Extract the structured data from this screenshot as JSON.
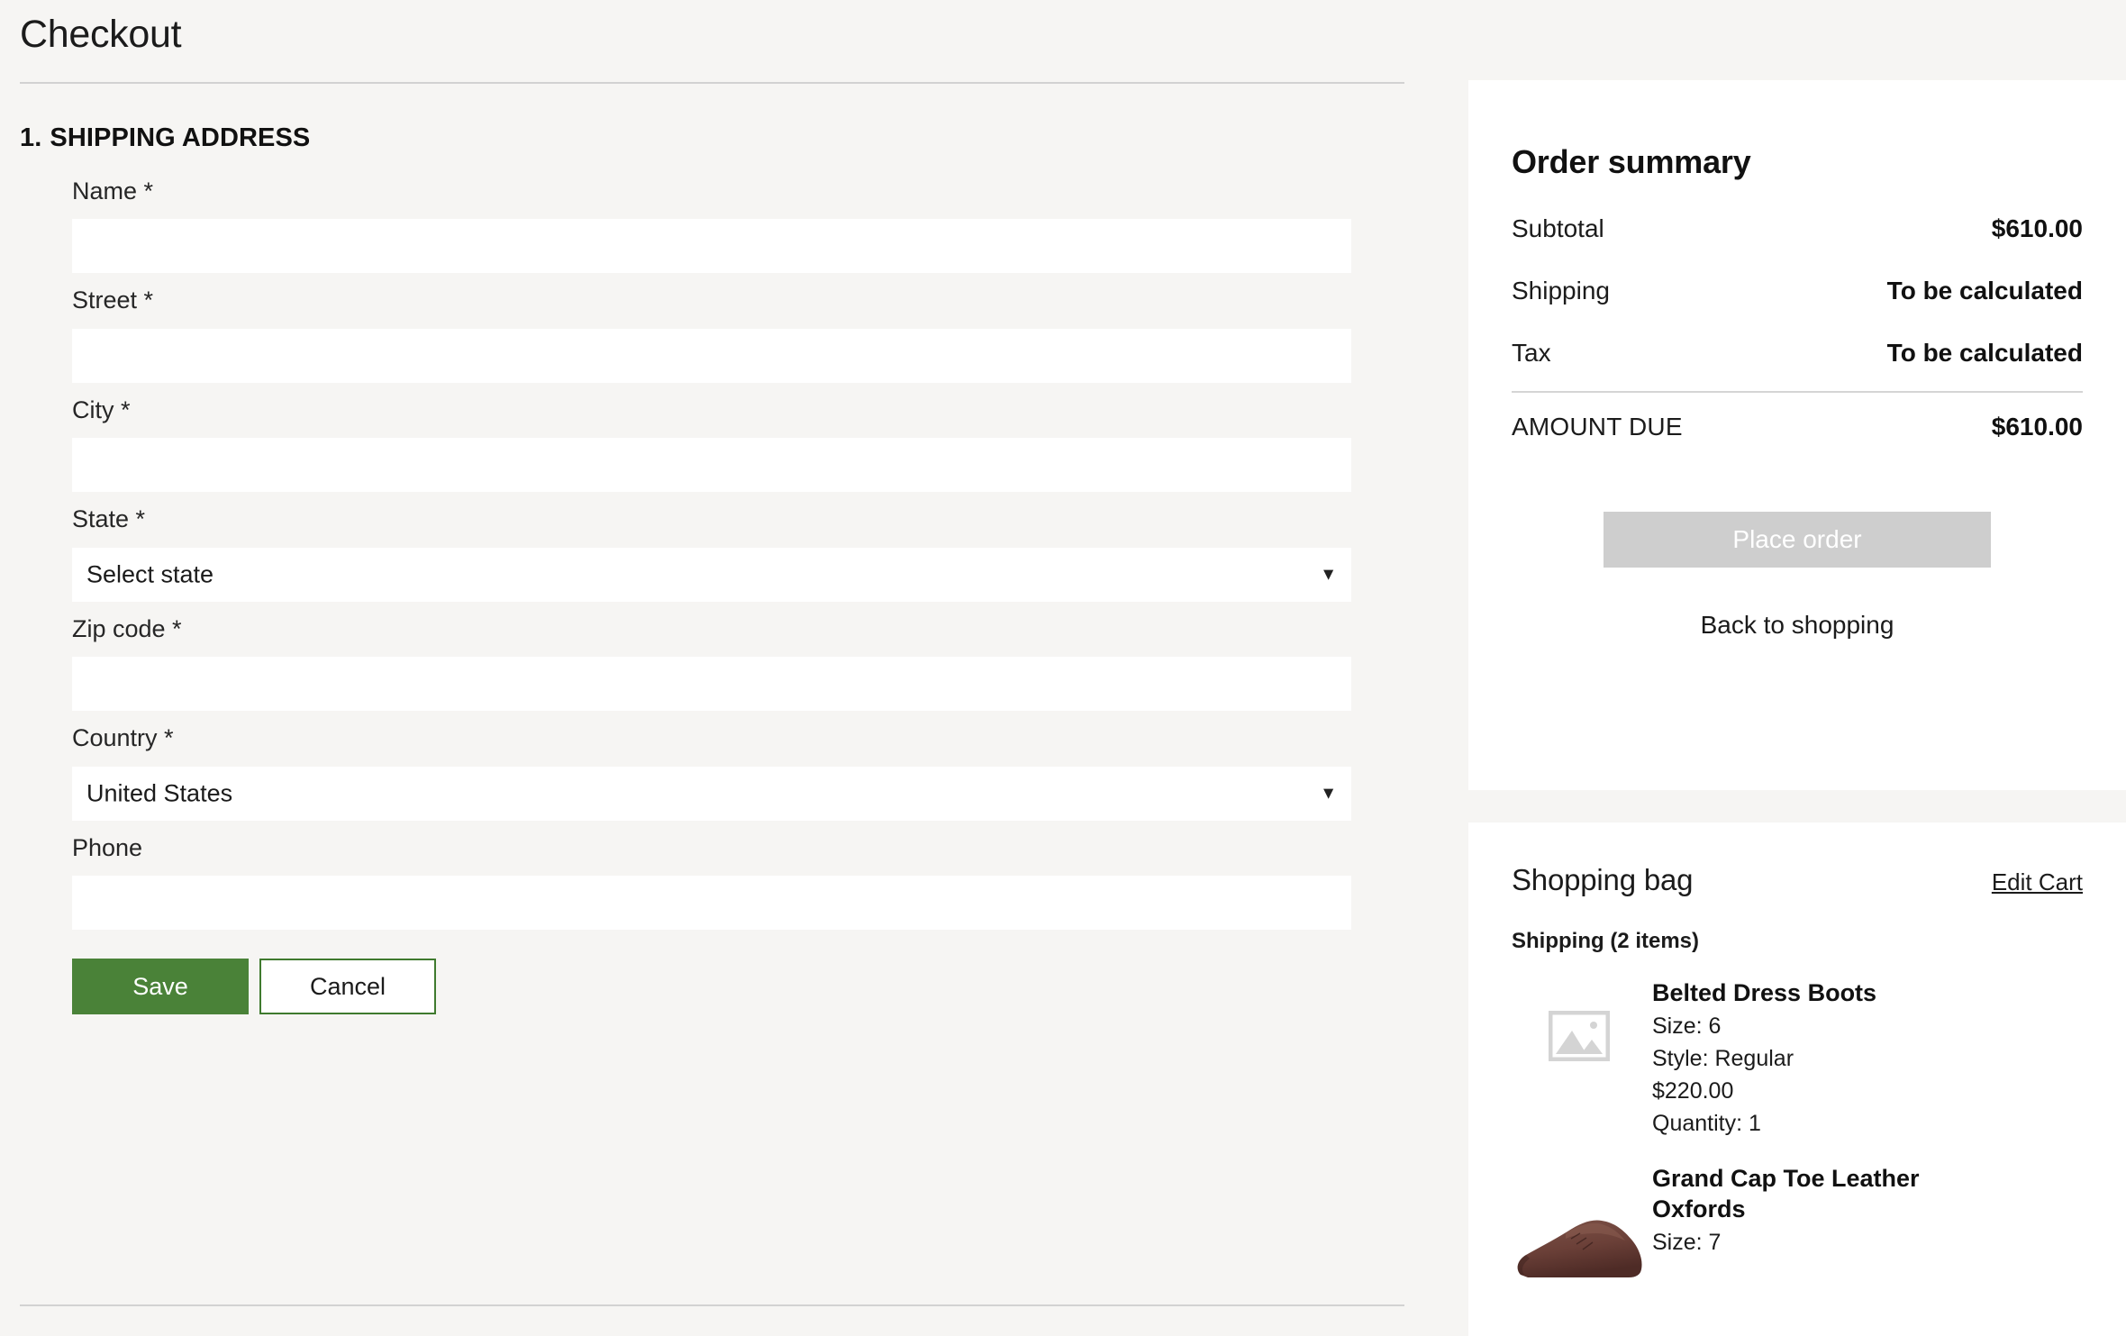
{
  "page": {
    "title": "Checkout"
  },
  "shipping_section": {
    "number": "1.",
    "heading": "SHIPPING ADDRESS",
    "fields": [
      {
        "label": "Name *",
        "type": "text",
        "value": "",
        "placeholder": ""
      },
      {
        "label": "Street *",
        "type": "text",
        "value": "",
        "placeholder": ""
      },
      {
        "label": "City *",
        "type": "text",
        "value": "",
        "placeholder": ""
      },
      {
        "label": "State *",
        "type": "select",
        "value": "Select state"
      },
      {
        "label": "Zip code *",
        "type": "text",
        "value": "",
        "placeholder": ""
      },
      {
        "label": "Country *",
        "type": "select",
        "value": "United States"
      },
      {
        "label": "Phone",
        "type": "text",
        "value": "",
        "placeholder": ""
      }
    ],
    "save_label": "Save",
    "cancel_label": "Cancel"
  },
  "order_summary": {
    "title": "Order summary",
    "rows": [
      {
        "label": "Subtotal",
        "value": "$610.00"
      },
      {
        "label": "Shipping",
        "value": "To be calculated"
      },
      {
        "label": "Tax",
        "value": "To be calculated"
      }
    ],
    "total_label": "AMOUNT DUE",
    "total_value": "$610.00",
    "place_order_label": "Place order",
    "back_to_shopping_label": "Back to shopping"
  },
  "shopping_bag": {
    "title": "Shopping bag",
    "edit_cart_label": "Edit Cart",
    "group_label": "Shipping (2 items)",
    "items": [
      {
        "name": "Belted Dress Boots",
        "size": "Size: 6",
        "style": "Style: Regular",
        "price": "$220.00",
        "quantity": "Quantity: 1",
        "image": "placeholder"
      },
      {
        "name": "Grand Cap Toe Leather Oxfords",
        "size": "Size: 7",
        "style": "",
        "price": "",
        "quantity": "",
        "image": "shoe-photo"
      }
    ]
  },
  "colors": {
    "page_background": "#f6f5f3",
    "card_background": "#ffffff",
    "save_green": "#4a8238",
    "cancel_border_green": "#3f7a2e",
    "disabled_gray": "#cecece",
    "divider": "#d2d2d2",
    "text": "#1b1b1b"
  }
}
